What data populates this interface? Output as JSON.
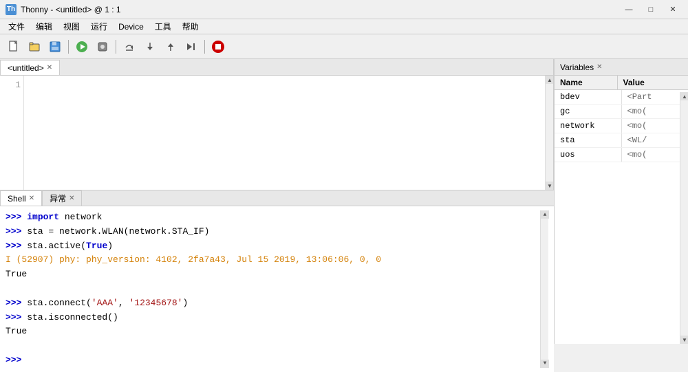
{
  "titleBar": {
    "icon": "Th",
    "title": "Thonny  -  <untitled>  @  1 : 1",
    "minimize": "—",
    "maximize": "□",
    "close": "✕"
  },
  "menuBar": {
    "items": [
      "文件",
      "编辑",
      "视图",
      "运行",
      "Device",
      "工具",
      "帮助"
    ]
  },
  "editorTabs": {
    "tabs": [
      {
        "label": "<untitled>",
        "active": true
      }
    ]
  },
  "editor": {
    "lineNumbers": [
      "1"
    ]
  },
  "shellTabs": {
    "tabs": [
      {
        "label": "Shell",
        "active": true
      },
      {
        "label": "异常",
        "active": false
      }
    ]
  },
  "shell": {
    "lines": [
      {
        "type": "command",
        "prompt": ">>>",
        "parts": [
          {
            "type": "kw",
            "text": "import"
          },
          {
            "type": "normal",
            "text": " network"
          }
        ]
      },
      {
        "type": "command",
        "prompt": ">>>",
        "parts": [
          {
            "type": "normal",
            "text": "sta = network.WLAN(network.STA_IF)"
          }
        ]
      },
      {
        "type": "command",
        "prompt": ">>>",
        "parts": [
          {
            "type": "normal",
            "text": "sta.active("
          },
          {
            "type": "kw",
            "text": "True"
          },
          {
            "type": "normal",
            "text": ")"
          }
        ]
      },
      {
        "type": "info",
        "text": "  I (52907) phy: phy_version: 4102, 2fa7a43, Jul 15 2019, 13:06:06, 0, 0"
      },
      {
        "type": "output",
        "text": "True"
      },
      {
        "type": "empty"
      },
      {
        "type": "command",
        "prompt": ">>>",
        "parts": [
          {
            "type": "normal",
            "text": "sta.connect("
          },
          {
            "type": "str",
            "text": "'AAA'"
          },
          {
            "type": "normal",
            "text": ", "
          },
          {
            "type": "str",
            "text": "'12345678'"
          },
          {
            "type": "normal",
            "text": ")"
          }
        ]
      },
      {
        "type": "command",
        "prompt": ">>>",
        "parts": [
          {
            "type": "normal",
            "text": "sta.isconnected()"
          }
        ]
      },
      {
        "type": "output",
        "text": "True"
      },
      {
        "type": "empty"
      },
      {
        "type": "prompt_only",
        "prompt": ">>>"
      }
    ]
  },
  "variables": {
    "tabLabel": "Variables",
    "header": {
      "name": "Name",
      "value": "Value"
    },
    "rows": [
      {
        "name": "bdev",
        "value": "<Part"
      },
      {
        "name": "gc",
        "value": "<mo("
      },
      {
        "name": "network",
        "value": "<mo("
      },
      {
        "name": "sta",
        "value": "<WL/"
      },
      {
        "name": "uos",
        "value": "<mo("
      }
    ]
  }
}
